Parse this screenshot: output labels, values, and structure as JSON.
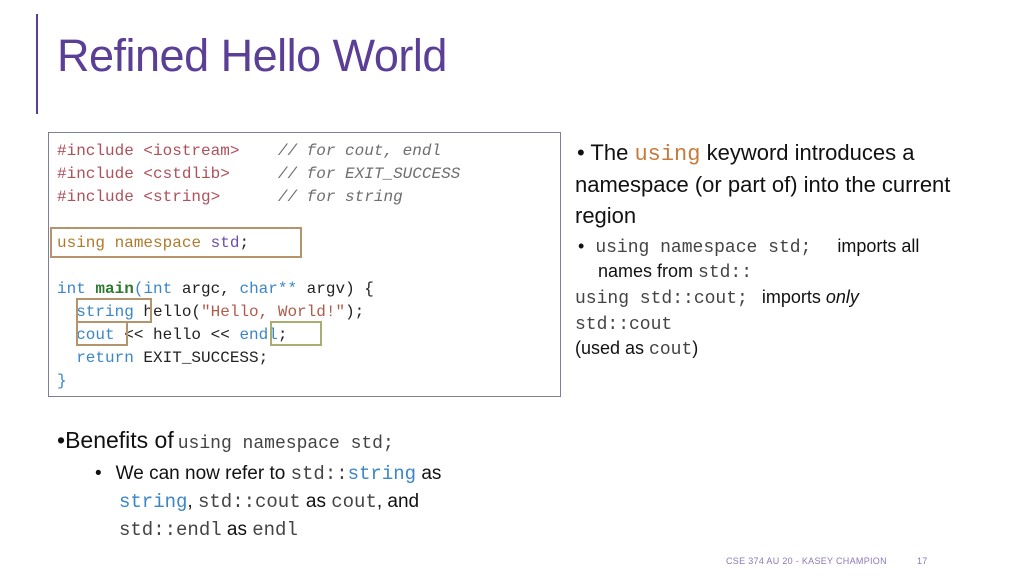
{
  "slide": {
    "title": "Refined Hello World",
    "footer_course": "CSE 374 AU 20 - KASEY CHAMPION",
    "page_number": "17"
  },
  "code": {
    "inc1_dir": "#include <iostream>",
    "inc1_cmt": "// for cout, endl",
    "inc2_dir": "#include <cstdlib>",
    "inc2_cmt": "// for EXIT_SUCCESS",
    "inc3_dir": "#include <string>",
    "inc3_cmt": "// for string",
    "using_kw": "using",
    "namespace_kw": "namespace",
    "std_name": "std",
    "semicolon": ";",
    "int_kw": "int",
    "main_fn": "main",
    "main_params_open": "(",
    "main_param1_name": " argc, ",
    "char_kw": "char**",
    "main_param2_name": " argv) {",
    "string_kw": "string",
    "hello_decl": " hello(",
    "hello_str": "\"Hello, World!\"",
    "hello_end": ");",
    "cout_kw": "cout",
    "cout_mid": " << hello << ",
    "endl_kw": "endl",
    "cout_end": ";",
    "return_kw": "return",
    "return_val": " EXIT_SUCCESS;",
    "close_brace": "}"
  },
  "right": {
    "b1_pre": "The ",
    "b1_code": "using",
    "b1_post": " keyword introduces a",
    "b1_line2": "namespace (or part of) into the current",
    "b1_line3": "region",
    "sub1_code": "using namespace std;",
    "sub1_text": "imports all",
    "sub1_line2_text": "names from ",
    "sub1_line2_code": "std::",
    "line3_code": "using std::cout;",
    "line3_text": "imports ",
    "line3_em": "only",
    "line4_code": "std::cout",
    "line5_text": "(used as ",
    "line5_code": "cout",
    "line5_end": ")"
  },
  "bottom": {
    "b_text": "Benefits of",
    "b_code": "using namespace std;",
    "s_pre": "We can now refer to ",
    "s_code1": "std::",
    "s_code1b": "string",
    "s_as1": " as",
    "s2_code": "string",
    "s2_comma": ", ",
    "s2_code2": "std::cout",
    "s2_as": " as ",
    "s2_code3": "cout",
    "s2_and": ", and",
    "s3_code": "std::endl",
    "s3_as": " as ",
    "s3_code2": "endl"
  }
}
